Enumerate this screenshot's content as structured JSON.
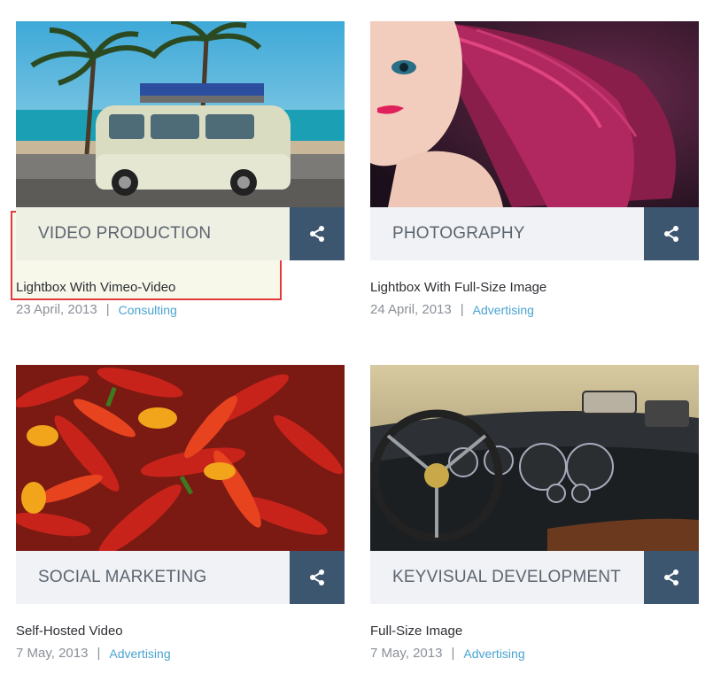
{
  "cards": [
    {
      "category": "VIDEO PRODUCTION",
      "title": "Lightbox With Vimeo-Video",
      "date": "23 April, 2013",
      "tag": "Consulting",
      "image": "vw-bus-beach-photo",
      "share_icon": "share-icon"
    },
    {
      "category": "PHOTOGRAPHY",
      "title": "Lightbox With Full-Size Image",
      "date": "24 April, 2013",
      "tag": "Advertising",
      "image": "red-hair-woman-photo",
      "share_icon": "share-icon"
    },
    {
      "category": "SOCIAL MARKETING",
      "title": "Self-Hosted Video",
      "date": "7 May, 2013",
      "tag": "Advertising",
      "image": "red-chili-peppers-photo",
      "share_icon": "share-icon"
    },
    {
      "category": "KEYVISUAL DEVELOPMENT",
      "title": "Full-Size Image",
      "date": "7 May, 2013",
      "tag": "Advertising",
      "image": "car-dashboard-photo",
      "share_icon": "share-icon"
    }
  ],
  "meta_separator": "|",
  "colors": {
    "share_bg": "#3d5670",
    "category_bg": "#f0f2f5",
    "tag_link": "#4aa3d2",
    "highlight_border": "#e23b3b"
  }
}
